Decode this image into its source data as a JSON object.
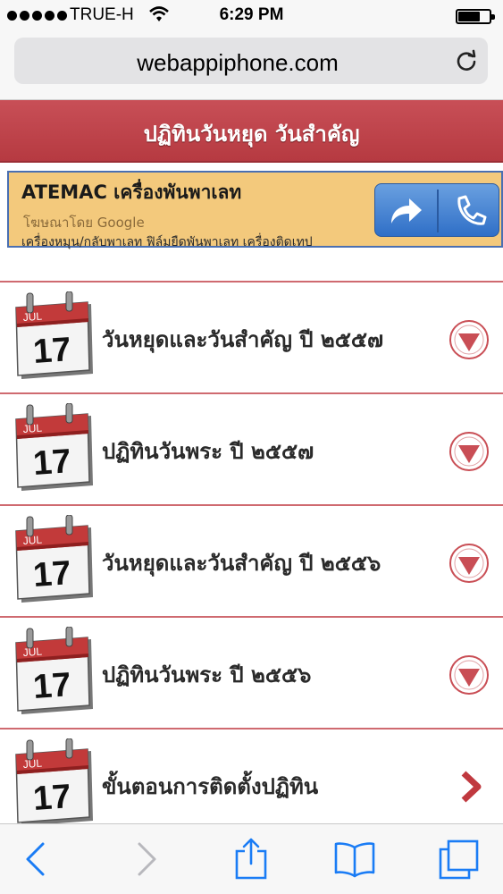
{
  "status_bar": {
    "carrier": "TRUE-H",
    "time": "6:29 PM",
    "battery_level": 0.7
  },
  "browser": {
    "url": "webappiphone.com"
  },
  "header": {
    "title": "ปฏิทินวันหยุด วันสำคัญ"
  },
  "ad": {
    "title": "ATEMAC เครื่องพันพาเลท",
    "sponsor": "โฆษณาโดย Google",
    "description": "เครื่องหมุน/กลับพาเลท ฟิล์มยืดพันพาเลท เครื่องติดเทป"
  },
  "calendar_icon": {
    "month": "JUL",
    "day": "17"
  },
  "list": {
    "items": [
      {
        "label": "วันหยุดและวันสำคัญ ปี ๒๕๕๗",
        "icon": "expand-down-icon"
      },
      {
        "label": "ปฏิทินวันพระ ปี ๒๕๕๗",
        "icon": "expand-down-icon"
      },
      {
        "label": "วันหยุดและวันสำคัญ ปี ๒๕๕๖",
        "icon": "expand-down-icon"
      },
      {
        "label": "ปฏิทินวันพระ ปี ๒๕๕๖",
        "icon": "expand-down-icon"
      },
      {
        "label": "ขั้นตอนการติดตั้งปฏิทิน",
        "icon": "chevron-right-icon"
      }
    ]
  },
  "colors": {
    "header": "#b63a41",
    "accent_blue": "#1a7cf5",
    "divider": "#cf6a70"
  }
}
